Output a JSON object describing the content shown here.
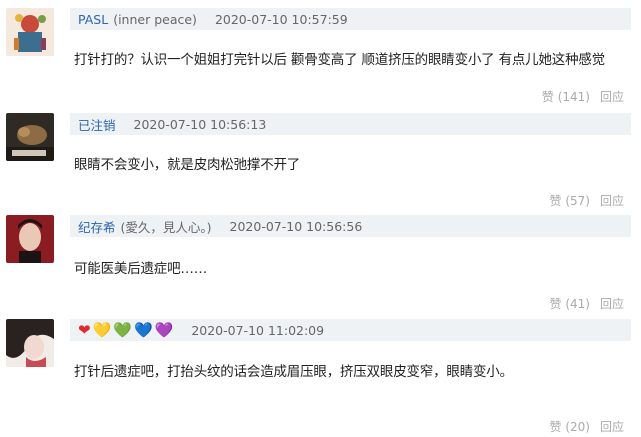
{
  "comments": [
    {
      "username": "PASL",
      "tag": "(inner peace)",
      "time": "2020-07-10 10:57:59",
      "text": "打针打的？认识一个姐姐打完针以后 颧骨变高了 顺道挤压的眼睛变小了 有点儿她这种感觉",
      "like_label": "赞 (141)",
      "reply_label": "回应"
    },
    {
      "username": "已注销",
      "tag": "",
      "time": "2020-07-10 10:56:13",
      "text": "眼睛不会变小，就是皮肉松弛撑不开了",
      "like_label": "赞 (57)",
      "reply_label": "回应"
    },
    {
      "username": "纪存希",
      "tag": "(愛久，見人心。)",
      "time": "2020-07-10 10:56:56",
      "text": "可能医美后遗症吧……",
      "like_label": "赞 (41)",
      "reply_label": "回应"
    },
    {
      "username": "",
      "username_hearts": [
        "❤",
        "💛",
        "💚",
        "💙",
        "💜"
      ],
      "tag": "",
      "time": "2020-07-10 11:02:09",
      "text": "打针后遗症吧，打抬头纹的话会造成眉压眼，挤压双眼皮变窄，眼睛变小。",
      "like_label": "赞 (20)",
      "reply_label": "回应"
    }
  ],
  "colors": {
    "username": "#2d64b3",
    "header_bg": "#eef2f5",
    "action": "#aaaaaa"
  }
}
